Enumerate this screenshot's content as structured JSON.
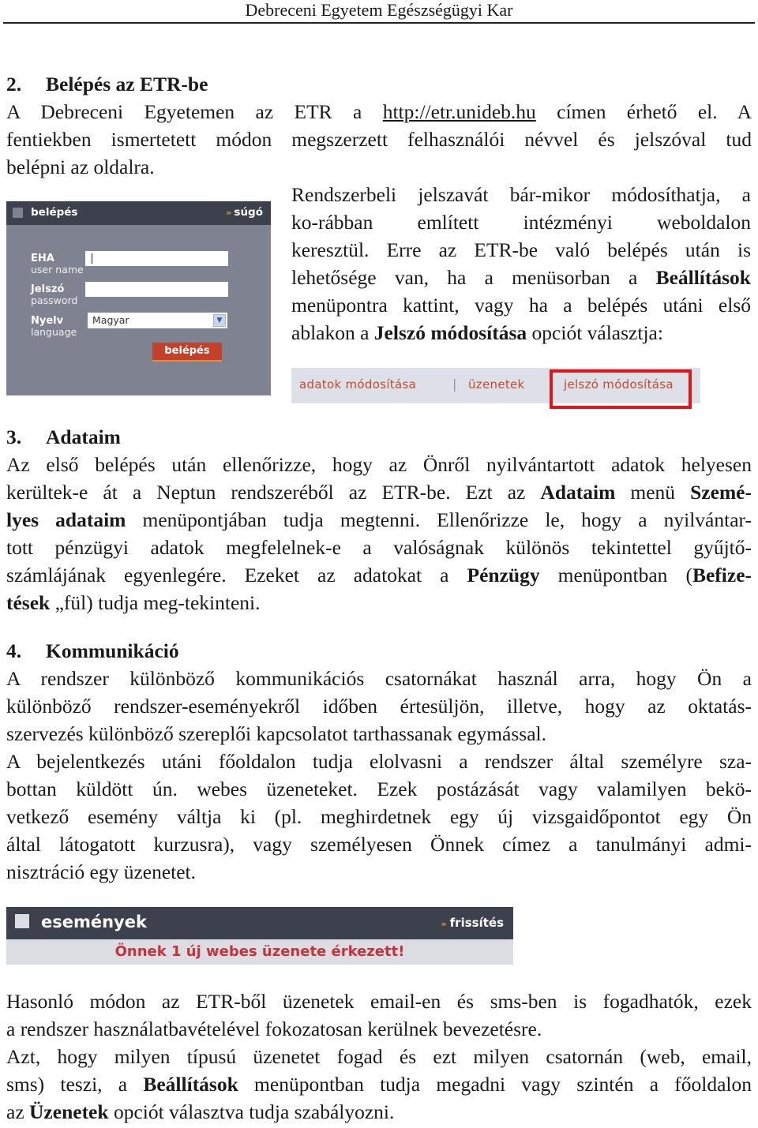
{
  "page": {
    "running_header": "Debreceni Egyetem Egészségügyi Kar"
  },
  "section2": {
    "number": "2.",
    "title": "Belépés az ETR-be",
    "intro_before_link": "A Debreceni Egyetemen az ETR a ",
    "link": "http://etr.unideb.hu",
    "intro_after_link": " címen érhető el. A",
    "intro_line2": "fentiekben ismertetett módon megszerzett felhasználói névvel és jelszóval tud",
    "intro_line3": "belépni az oldalra.",
    "side_lines": [
      "Rendszerbeli jelszavát bár-mikor módosíthatja, a",
      "ko-rábban említett intézményi weboldalon",
      "keresztül. Erre az ETR-be való belépés után is"
    ],
    "side_line4_before": "lehetősége van, ha a menüsorban a ",
    "side_line4_bold": "Beállítások",
    "side_line5": "menüpontra kattint, vagy ha a belépés utáni első",
    "side_line6_before": "ablakon a ",
    "side_line6_bold": "Jelszó módosítása",
    "side_line6_after": " opciót választja:"
  },
  "login_panel": {
    "title": "belépés",
    "help_link": "súgó",
    "username_label": "EHA",
    "username_sublabel": "user name",
    "username_value": "",
    "password_label": "Jelszó",
    "password_sublabel": "password",
    "password_value": "",
    "language_label": "Nyelv",
    "language_sublabel": "language",
    "language_selected": "Magyar",
    "submit_label": "belépés",
    "colors": {
      "header": "#3d404d",
      "body": "#7e8291",
      "button": "#c2412b",
      "accent": "#e89a2c"
    }
  },
  "settings_tabs": {
    "items": [
      "adatok módosítása",
      "üzenetek",
      "jelszó módosítása"
    ],
    "separator": "|",
    "highlighted": "jelszó módosítása",
    "colors": {
      "text": "#c24a33",
      "highlight_border": "#e0141b",
      "background": "#dde0e6"
    }
  },
  "section3": {
    "number": "3.",
    "title": "Adataim",
    "lines": [
      [
        "Az első belépés után ellenőrizze, hogy az Önről nyilvántartott adatok helyesen"
      ],
      [
        "kerültek-e át a Neptun rendszeréből az ETR-be. Ezt az ",
        {
          "b": "Adataim"
        },
        " menü ",
        {
          "b": "Szemé-"
        }
      ],
      [
        {
          "b": "lyes adataim"
        },
        " menüpontjában tudja megtenni. Ellenőrizze le, hogy a nyilvántar-"
      ],
      [
        "tott pénzügyi adatok megfelelnek-e a valóságnak különös tekintettel gyűjtő-"
      ],
      [
        "számlájának egyenlegére. Ezeket az adatokat a ",
        {
          "b": "Pénzügy"
        },
        " menüpontban (",
        {
          "b": "Befize-"
        }
      ],
      [
        {
          "b": "tések"
        },
        " „fül) tudja meg-tekinteni."
      ]
    ]
  },
  "section4": {
    "number": "4.",
    "title": "Kommunikáció",
    "lines": [
      "A rendszer különböző kommunikációs csatornákat használ arra, hogy Ön a",
      "különböző rendszer-eseményekről időben értesüljön, illetve, hogy az oktatás-",
      "szervezés különböző szereplői kapcsolatot tarthassanak egymással.",
      "A bejelentkezés utáni  főoldalon tudja elolvasni a rendszer által személyre sza-",
      "bottan küldött ún. webes üzeneteket. Ezek postázását vagy valamilyen bekö-",
      "vetkező esemény váltja ki (pl. meghirdetnek egy új vizsgaidőpontot egy Ön",
      "által látogatott kurzusra), vagy személyesen Önnek címez a tanulmányi admi-",
      "nisztráció egy üzenetet."
    ]
  },
  "events_panel": {
    "title": "események",
    "refresh_link": "frissítés",
    "message": "Önnek 1 új webes üzenete érkezett!",
    "colors": {
      "header": "#3d404d",
      "message": "#c6323a",
      "body": "#dcdde2"
    }
  },
  "closing": {
    "line1": "Hasonló módon az ETR-ből üzenetek email-en és sms-ben is fogadhatók, ezek",
    "line2": "a rendszer használatbavételével  fokozatosan kerülnek bevezetésre.",
    "line3": "Azt, hogy milyen típusú üzenetet fogad és ezt milyen csatornán (web, email,",
    "line4_before": "sms) teszi, a ",
    "line4_bold": "Beállítások",
    "line4_after": " menüpontban tudja megadni vagy szintén a főoldalon",
    "line5_before": "az ",
    "line5_bold": "Üzenetek",
    "line5_after": " opciót választva tudja szabályozni."
  }
}
